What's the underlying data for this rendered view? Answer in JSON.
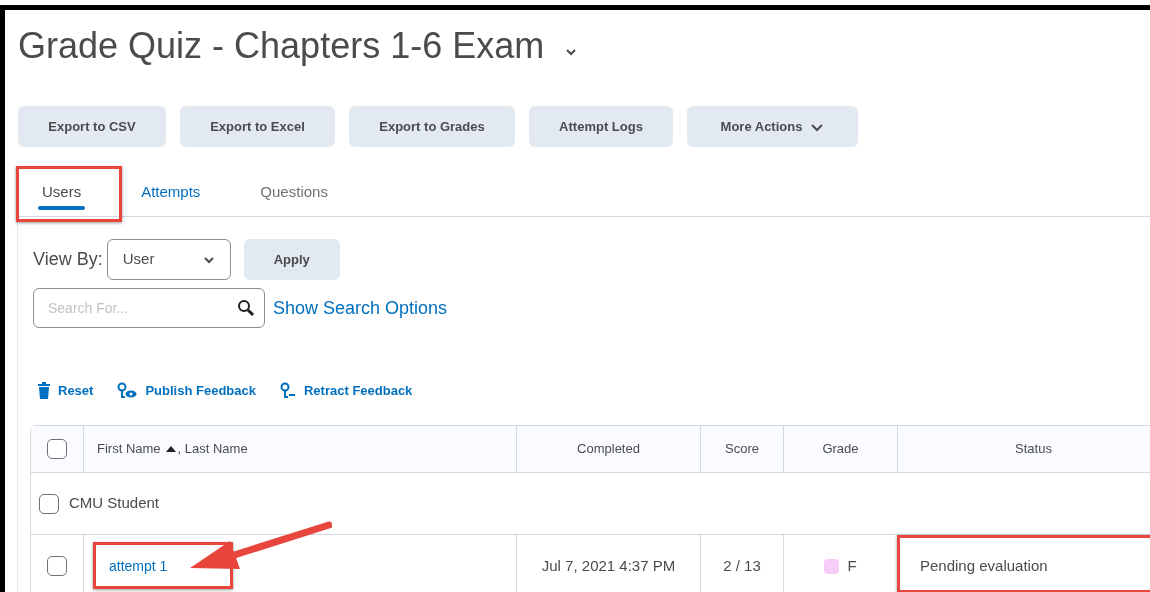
{
  "title": "Grade Quiz - Chapters 1-6 Exam",
  "buttons": [
    {
      "label": "Export to CSV",
      "kind": "plain"
    },
    {
      "label": "Export to Excel",
      "kind": "plain"
    },
    {
      "label": "Export to Grades",
      "kind": "plain"
    },
    {
      "label": "Attempt Logs",
      "kind": "plain"
    },
    {
      "label": "More Actions",
      "kind": "menu"
    }
  ],
  "tabs": [
    {
      "label": "Users",
      "selected": true
    },
    {
      "label": "Attempts",
      "selected": false
    },
    {
      "label": "Questions",
      "selected": false
    }
  ],
  "view_by": {
    "label": "View By:",
    "value": "User",
    "apply": "Apply"
  },
  "search": {
    "placeholder": "Search For...",
    "options_link": "Show Search Options"
  },
  "actions": [
    {
      "label": "Reset",
      "kind": "delete"
    },
    {
      "label": "Publish Feedback",
      "kind": "publish"
    },
    {
      "label": "Retract Feedback",
      "kind": "retract"
    }
  ],
  "table": {
    "select_all_checked": false,
    "name_column": {
      "first": "First Name",
      "last": ", Last Name"
    },
    "columns": [
      "Completed",
      "Score",
      "Grade",
      "Status"
    ],
    "groups": [
      {
        "name": "CMU Student",
        "checked": false,
        "rows": [
          {
            "attempt": "attempt 1",
            "completed": "Jul 7, 2021 4:37 PM",
            "score": "2 / 13",
            "grade": "F",
            "status": "Pending evaluation",
            "checked": false
          }
        ]
      }
    ]
  }
}
